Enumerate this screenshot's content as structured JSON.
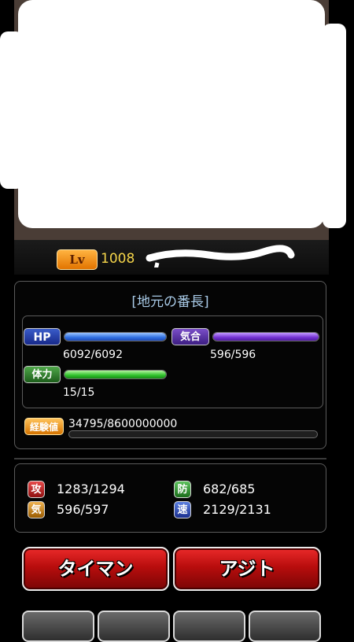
{
  "level": {
    "badge": "Lv",
    "value": "1008"
  },
  "character": {
    "name": "[地元の番長]"
  },
  "gauges": {
    "hp": {
      "label": "HP",
      "text": "6092/6092",
      "fraction": 1.0
    },
    "ki": {
      "label": "気合",
      "text": "596/596",
      "fraction": 1.0
    },
    "stamina": {
      "label": "体力",
      "text": "15/15",
      "fraction": 1.0
    },
    "exp": {
      "label": "経験値",
      "text": "34795/8600000000",
      "fraction": 0.0
    }
  },
  "stats": {
    "attack": {
      "icon": "攻",
      "value": "1283/1294"
    },
    "defense": {
      "icon": "防",
      "value": "682/685"
    },
    "ki": {
      "icon": "気",
      "value": "596/597"
    },
    "speed": {
      "icon": "速",
      "value": "2129/2131"
    }
  },
  "buttons": {
    "taiman": "タイマン",
    "ajito": "アジト"
  },
  "bottom_buttons": [
    "",
    "",
    "",
    ""
  ],
  "colors": {
    "accent": "#f5d54a",
    "button_red": "#c10f0f",
    "name": "#a9cbe8"
  }
}
